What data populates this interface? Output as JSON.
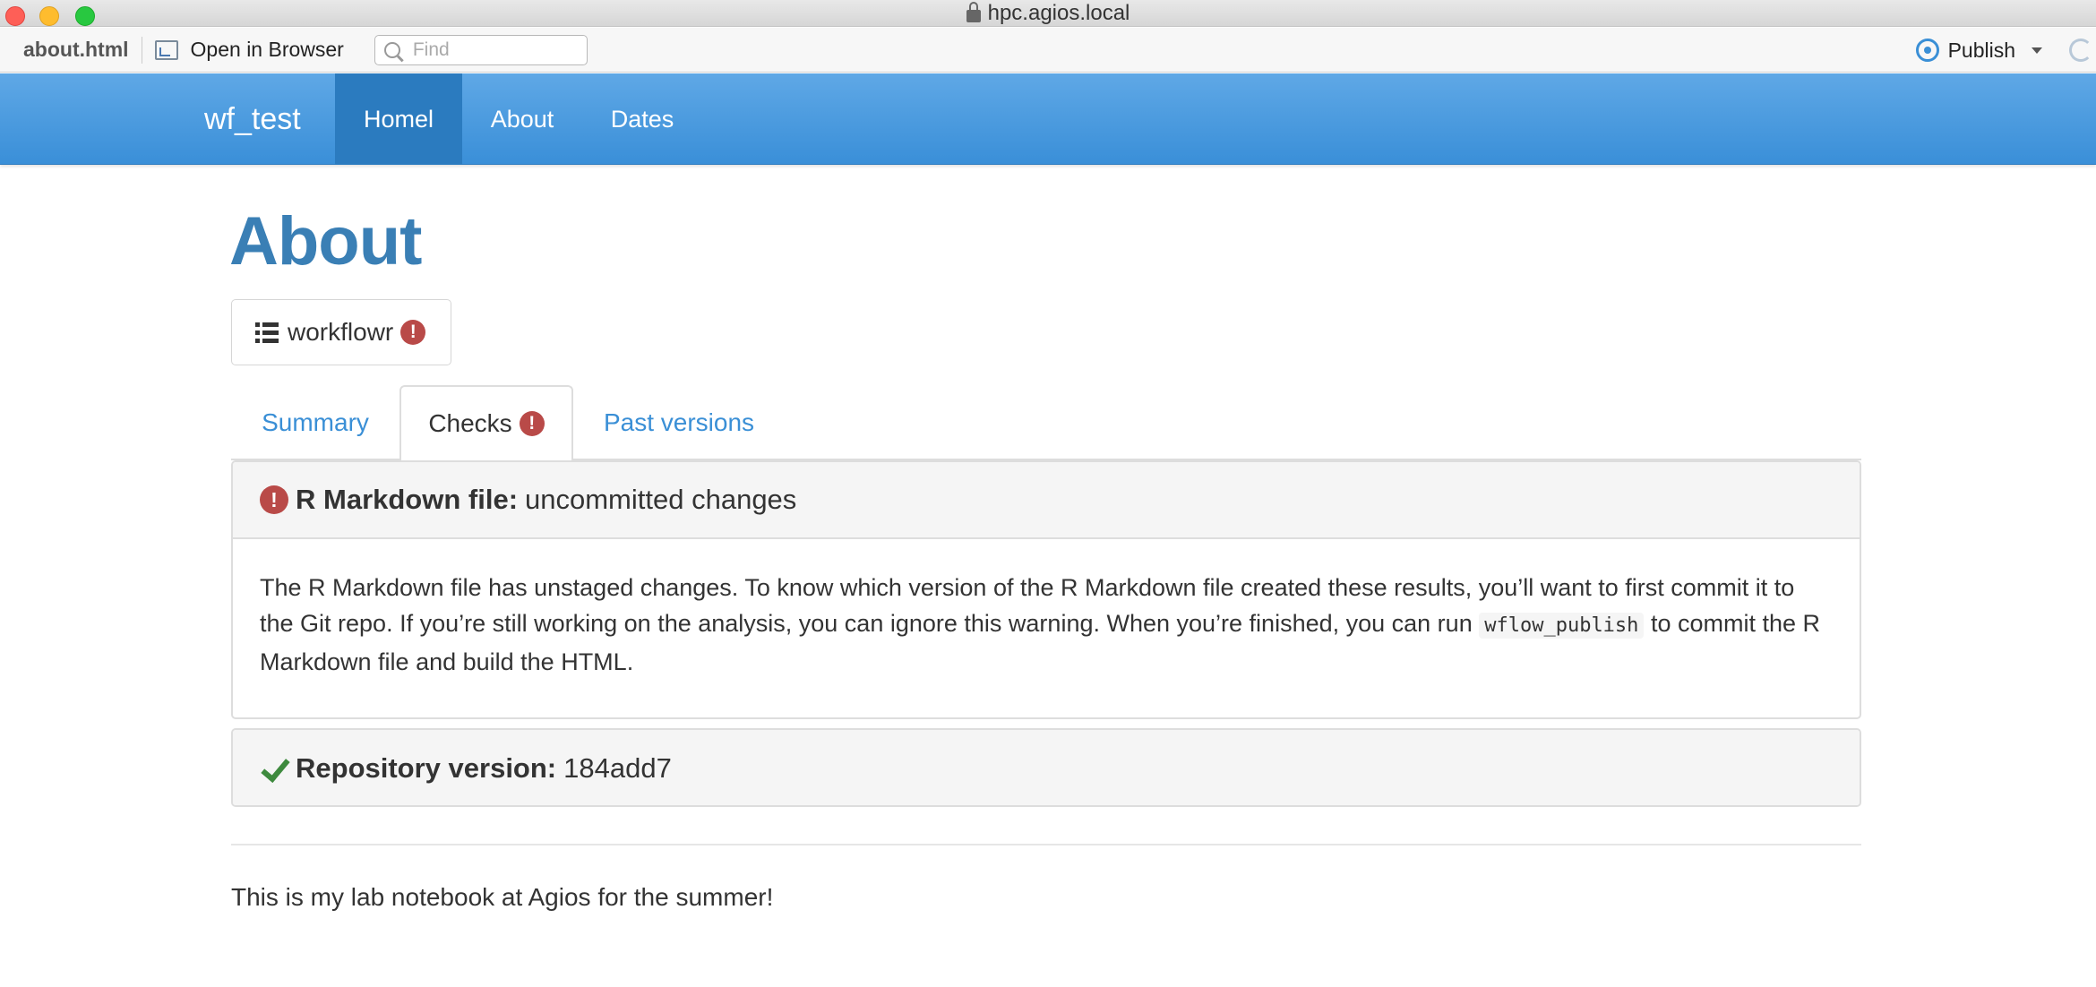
{
  "window": {
    "title": "hpc.agios.local"
  },
  "toolbar": {
    "file_name": "about.html",
    "open_in_browser": "Open in Browser",
    "find_placeholder": "Find",
    "publish_label": "Publish"
  },
  "navbar": {
    "brand": "wf_test",
    "items": [
      {
        "label": "Homel",
        "active": true
      },
      {
        "label": "About",
        "active": false
      },
      {
        "label": "Dates",
        "active": false
      }
    ]
  },
  "page": {
    "title": "About",
    "workflowr_button": "workflowr",
    "tabs": [
      {
        "label": "Summary",
        "active": false
      },
      {
        "label": "Checks",
        "active": true
      },
      {
        "label": "Past versions",
        "active": false
      }
    ],
    "panels": [
      {
        "heading_bold": "R Markdown file:",
        "heading_rest": "uncommitted changes",
        "body_before_code": "The R Markdown file has unstaged changes. To know which version of the R Markdown file created these results, you’ll want to first commit it to the Git repo. If you’re still working on the analysis, you can ignore this warning. When you’re finished, you can run",
        "body_code": "wflow_publish",
        "body_after_code": "to commit the R Markdown file and build the HTML."
      },
      {
        "heading_bold": "Repository version:",
        "heading_rest": "184add7"
      }
    ],
    "intro_text": "This is my lab notebook at Agios for the summer!"
  },
  "colors": {
    "navbar": "#3a8fd8",
    "navbar_active": "#2b7bbf",
    "title": "#3a7fb5",
    "link": "#3a8fd6",
    "alert": "#b94a48",
    "success": "#3e8a3e"
  }
}
